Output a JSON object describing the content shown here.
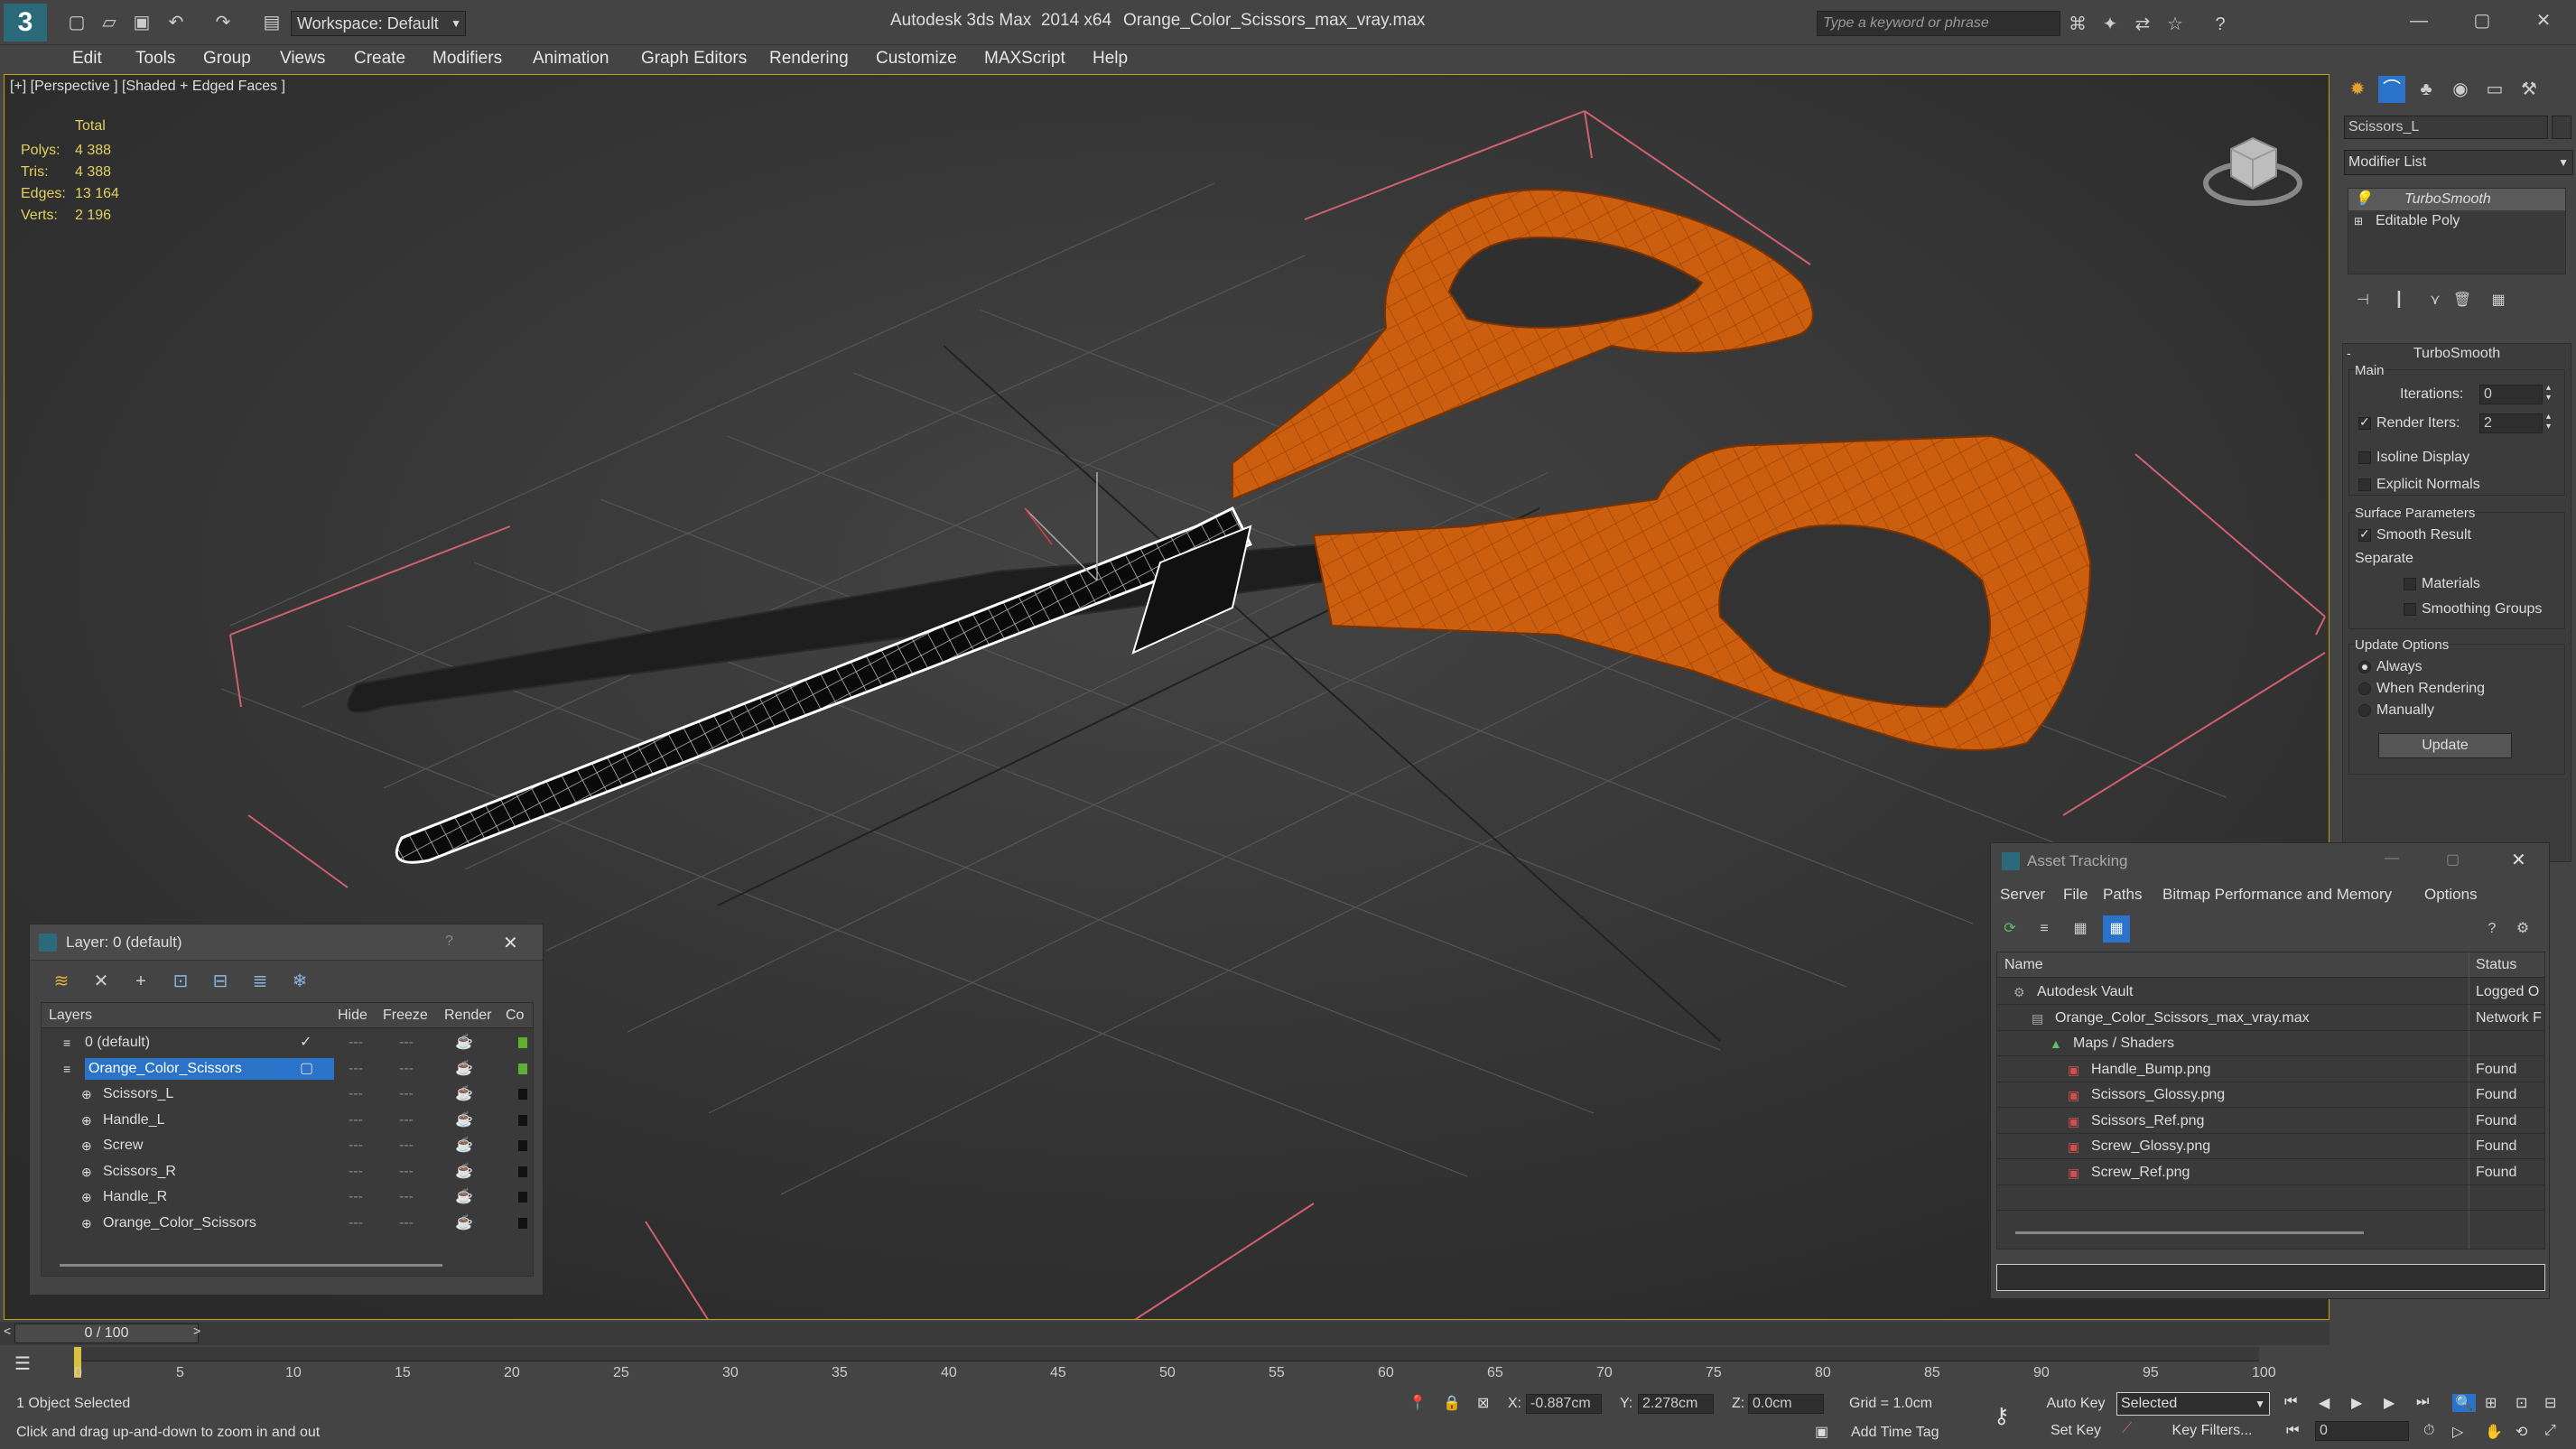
{
  "titlebar": {
    "workspace": "Workspace: Default",
    "app_title": "Autodesk 3ds Max  2014 x64",
    "file_name": "Orange_Color_Scissors_max_vray.max",
    "search_placeholder": "Type a keyword or phrase"
  },
  "menu": [
    "Edit",
    "Tools",
    "Group",
    "Views",
    "Create",
    "Modifiers",
    "Animation",
    "Graph Editors",
    "Rendering",
    "Customize",
    "MAXScript",
    "Help"
  ],
  "viewport": {
    "label": "[+] [Perspective ] [Shaded + Edged Faces ]",
    "stats": {
      "total_label": "Total",
      "rows": [
        {
          "label": "Polys:",
          "value": "4 388"
        },
        {
          "label": "Tris:",
          "value": "4 388"
        },
        {
          "label": "Edges:",
          "value": "13 164"
        },
        {
          "label": "Verts:",
          "value": "2 196"
        }
      ]
    }
  },
  "command_panel": {
    "object_name": "Scissors_L",
    "modifier_list": "Modifier List",
    "stack": [
      "TurboSmooth",
      "Editable Poly"
    ],
    "rollout_title": "TurboSmooth",
    "main_label": "Main",
    "iterations_label": "Iterations:",
    "iterations_value": "0",
    "render_iters_label": "Render Iters:",
    "render_iters_value": "2",
    "isoline_label": "Isoline Display",
    "explicit_normals_label": "Explicit Normals",
    "surface_params_label": "Surface Parameters",
    "smooth_result_label": "Smooth Result",
    "separate_label": "Separate",
    "materials_label": "Materials",
    "smoothing_groups_label": "Smoothing Groups",
    "update_options_label": "Update Options",
    "always_label": "Always",
    "when_rendering_label": "When Rendering",
    "manually_label": "Manually",
    "update_button": "Update"
  },
  "layer_window": {
    "title": "Layer: 0 (default)",
    "help": "?",
    "columns": [
      "Layers",
      "Hide",
      "Freeze",
      "Render",
      "Co"
    ],
    "rows": [
      {
        "name": "0 (default)",
        "indent": 1
      },
      {
        "name": "Orange_Color_Scissors",
        "indent": 1
      },
      {
        "name": "Scissors_L",
        "indent": 2
      },
      {
        "name": "Handle_L",
        "indent": 2
      },
      {
        "name": "Screw",
        "indent": 2
      },
      {
        "name": "Scissors_R",
        "indent": 2
      },
      {
        "name": "Handle_R",
        "indent": 2
      },
      {
        "name": "Orange_Color_Scissors",
        "indent": 2
      }
    ]
  },
  "asset_window": {
    "title": "Asset Tracking",
    "menu": [
      "Server",
      "File",
      "Paths",
      "Bitmap Performance and Memory",
      "Options"
    ],
    "columns": [
      "Name",
      "Status"
    ],
    "rows": [
      {
        "name": "Autodesk Vault",
        "status": "Logged O",
        "indent": 1
      },
      {
        "name": "Orange_Color_Scissors_max_vray.max",
        "status": "Network F",
        "indent": 2
      },
      {
        "name": "Maps / Shaders",
        "status": "",
        "indent": 3
      },
      {
        "name": "Handle_Bump.png",
        "status": "Found",
        "indent": 4
      },
      {
        "name": "Scissors_Glossy.png",
        "status": "Found",
        "indent": 4
      },
      {
        "name": "Scissors_Ref.png",
        "status": "Found",
        "indent": 4
      },
      {
        "name": "Screw_Glossy.png",
        "status": "Found",
        "indent": 4
      },
      {
        "name": "Screw_Ref.png",
        "status": "Found",
        "indent": 4
      }
    ]
  },
  "timeline": {
    "frame": "0 / 100",
    "ticks": [
      "0",
      "5",
      "10",
      "15",
      "20",
      "25",
      "30",
      "35",
      "40",
      "45",
      "50",
      "55",
      "60",
      "65",
      "70",
      "75",
      "80",
      "85",
      "90",
      "95",
      "100"
    ]
  },
  "status": {
    "selected": "1 Object Selected",
    "prompt": "Click and drag up-and-down to zoom in and out",
    "x_label": "X:",
    "x_value": "-0.887cm",
    "y_label": "Y:",
    "y_value": "2.278cm",
    "z_label": "Z:",
    "z_value": "0.0cm",
    "grid": "Grid = 1.0cm",
    "add_time_tag": "Add Time Tag",
    "auto_key": "Auto Key",
    "set_key": "Set Key",
    "selected_dropdown": "Selected",
    "key_filters": "Key Filters...",
    "frame_field": "0"
  },
  "colors": {
    "accent_blue": "#2a73c8",
    "orange_handle": "#d0600f",
    "viewport_border": "#c8a000",
    "stats_yellow": "#e0d060"
  }
}
